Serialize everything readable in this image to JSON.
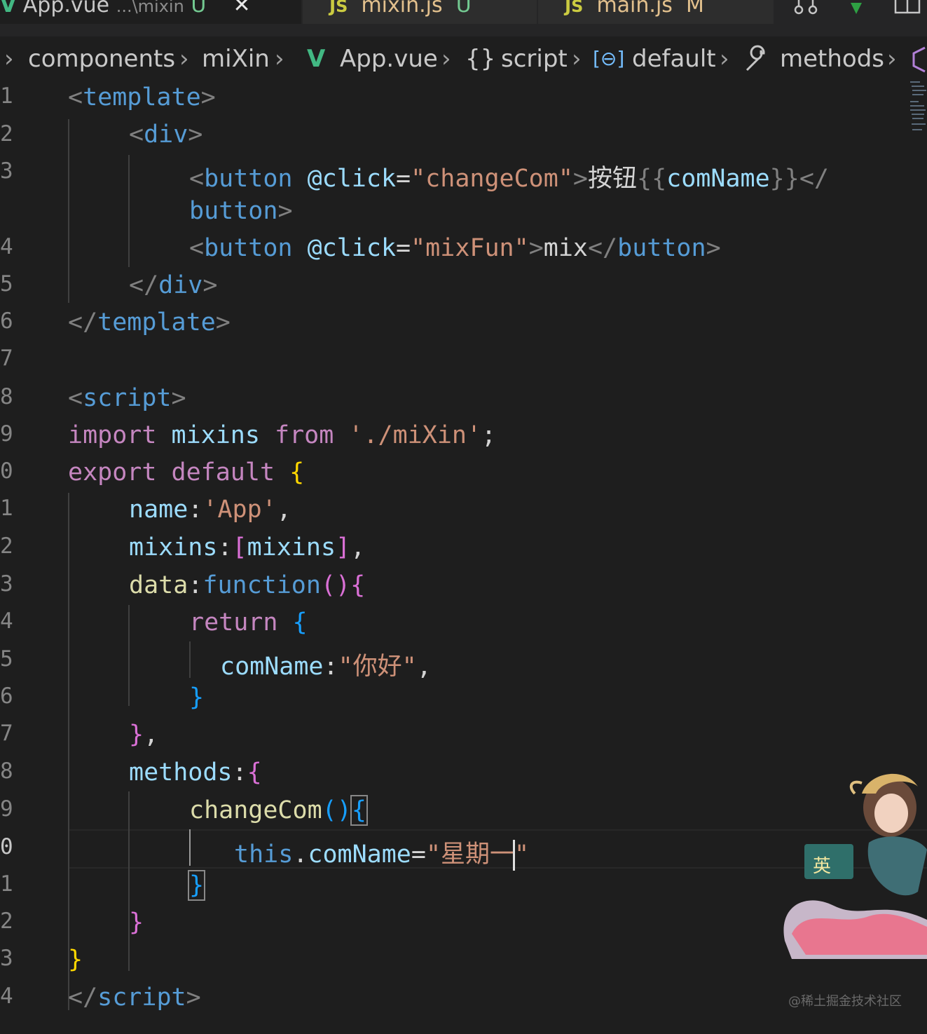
{
  "tabs": [
    {
      "file": "App.vue",
      "path": "...\\mixin",
      "status": "U"
    },
    {
      "file": "mixin.js",
      "status": "U"
    },
    {
      "file": "main.js",
      "status": "M"
    }
  ],
  "icons": {
    "vue": "vue-logo-icon",
    "js": "js-file-icon",
    "close": "close-icon",
    "compare": "compare-changes-icon",
    "split": "split-editor-icon"
  },
  "tab_icon_text": {
    "vue": "V",
    "js": "JS",
    "close": "✕"
  },
  "breadcrumb": {
    "items": [
      "components",
      "miXin",
      "App.vue",
      "script",
      "default",
      "methods"
    ],
    "glyphs": {
      "sep": "›",
      "vue": "V",
      "braces": "{}",
      "obj": "[⊖]",
      "wrench": "🔧"
    }
  },
  "line_numbers": [
    "1",
    "2",
    "3",
    "",
    "4",
    "5",
    "6",
    "7",
    "8",
    "9",
    "0",
    "1",
    "2",
    "3",
    "4",
    "5",
    "6",
    "7",
    "8",
    "9",
    "0",
    "1",
    "2",
    "3",
    "4"
  ],
  "code": {
    "l1": [
      "<",
      "template",
      ">"
    ],
    "l2": [
      "<",
      "div",
      ">"
    ],
    "l3": [
      "<",
      "button",
      " ",
      "@click",
      "=",
      "\"changeCom\"",
      ">",
      "按钮",
      "{{",
      "comName",
      "}}",
      "</"
    ],
    "l3b": [
      "button",
      ">"
    ],
    "l4": [
      "<",
      "button",
      " ",
      "@click",
      "=",
      "\"mixFun\"",
      ">",
      "mix",
      "</",
      "button",
      ">"
    ],
    "l5": [
      "</",
      "div",
      ">"
    ],
    "l6": [
      "</",
      "template",
      ">"
    ],
    "l8": [
      "<",
      "script",
      ">"
    ],
    "l9": [
      "import",
      " mixins ",
      "from",
      " ",
      "'./miXin'",
      ";"
    ],
    "l10": [
      "export",
      " ",
      "default",
      " ",
      "{"
    ],
    "l11": [
      "name",
      ":",
      "'App'",
      ","
    ],
    "l12": [
      "mixins",
      ":",
      "[",
      "mixins",
      "]",
      ","
    ],
    "l13": [
      "data",
      ":",
      "function",
      "(",
      ")",
      "{"
    ],
    "l14": [
      "return",
      " ",
      "{"
    ],
    "l15": [
      "comName",
      ":",
      "\"你好\"",
      ","
    ],
    "l16": [
      "}"
    ],
    "l17": [
      "}",
      ","
    ],
    "l18": [
      "methods",
      ":",
      "{"
    ],
    "l19": [
      "changeCom",
      "(",
      ")",
      "{"
    ],
    "l20": [
      "this",
      ".",
      "comName",
      "=",
      "\"星期一",
      "\""
    ],
    "l21": [
      "}"
    ],
    "l22": [
      "}"
    ],
    "l23": [
      "}"
    ],
    "l24": [
      "</",
      "script",
      ">"
    ]
  },
  "watermark": "@稀土掘金技术社区",
  "colors": {
    "background": "#1e1e1e",
    "tag": "#569cd6",
    "attribute": "#9cdcfe",
    "string": "#ce9178",
    "keyword": "#c586c0",
    "function": "#dcdcaa",
    "bracket1": "#ffd700",
    "bracket2": "#da70d6",
    "bracket3": "#179fff"
  }
}
